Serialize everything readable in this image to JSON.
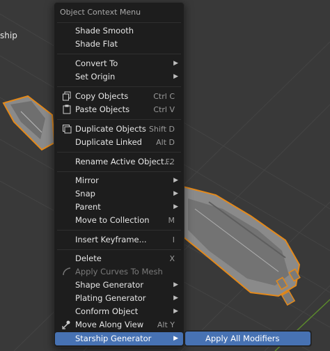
{
  "viewport": {
    "object_label": "ship"
  },
  "menu": {
    "title": "Object Context Menu",
    "items": [
      {
        "label": "Shade Smooth",
        "shortcut": ""
      },
      {
        "label": "Shade Flat",
        "shortcut": ""
      },
      {
        "label": "Convert To",
        "shortcut": ""
      },
      {
        "label": "Set Origin",
        "shortcut": ""
      },
      {
        "label": "Copy Objects",
        "shortcut": "Ctrl C"
      },
      {
        "label": "Paste Objects",
        "shortcut": "Ctrl V"
      },
      {
        "label": "Duplicate Objects",
        "shortcut": "Shift D"
      },
      {
        "label": "Duplicate Linked",
        "shortcut": "Alt D"
      },
      {
        "label": "Rename Active Object...",
        "shortcut": "F2"
      },
      {
        "label": "Mirror",
        "shortcut": ""
      },
      {
        "label": "Snap",
        "shortcut": ""
      },
      {
        "label": "Parent",
        "shortcut": ""
      },
      {
        "label": "Move to Collection",
        "shortcut": "M"
      },
      {
        "label": "Insert Keyframe...",
        "shortcut": "I"
      },
      {
        "label": "Delete",
        "shortcut": "X"
      },
      {
        "label": "Apply Curves To Mesh",
        "shortcut": ""
      },
      {
        "label": "Shape Generator",
        "shortcut": ""
      },
      {
        "label": "Plating Generator",
        "shortcut": ""
      },
      {
        "label": "Conform Object",
        "shortcut": ""
      },
      {
        "label": "Move Along View",
        "shortcut": "Alt Y"
      },
      {
        "label": "Starship Generator",
        "shortcut": ""
      }
    ]
  },
  "submenu": {
    "items": [
      {
        "label": "Apply All Modifiers"
      }
    ]
  },
  "icons": {
    "copy": "copy-icon",
    "paste": "paste-icon",
    "duplicate": "duplicate-icon",
    "apply_curves": "curve-icon",
    "move_along_view": "move-icon",
    "submenu_arrow": "chevron-right-icon"
  },
  "colors": {
    "menu_bg": "#1d1d1d",
    "highlight": "#4772b3",
    "selection_outline": "#e3891b"
  }
}
